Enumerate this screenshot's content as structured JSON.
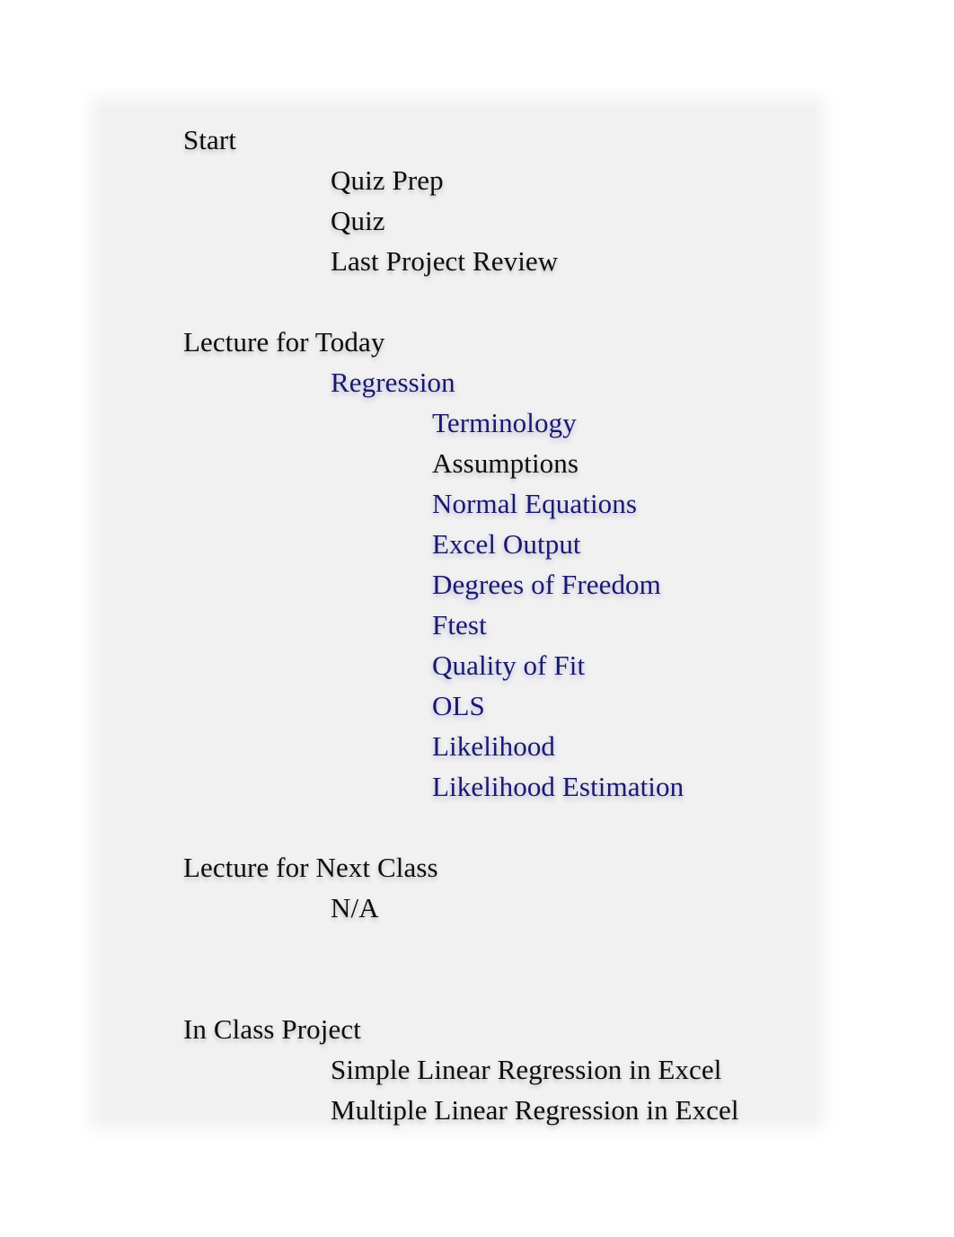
{
  "document": {
    "page_background": "#f1f1f1",
    "canvas_background": "#ffffff",
    "text_color": "#0d0d0d",
    "link_color": "#191970"
  },
  "outline": {
    "sections": [
      {
        "heading": "Start",
        "items": [
          {
            "label": "Quiz Prep",
            "level": 1,
            "style": "plain"
          },
          {
            "label": "Quiz",
            "level": 1,
            "style": "plain"
          },
          {
            "label": "Last Project Review",
            "level": 1,
            "style": "plain"
          }
        ]
      },
      {
        "heading": "Lecture for Today",
        "items": [
          {
            "label": "Regression",
            "level": 1,
            "style": "link"
          },
          {
            "label": "Terminology",
            "level": 2,
            "style": "link"
          },
          {
            "label": "Assumptions",
            "level": 2,
            "style": "plain"
          },
          {
            "label": "Normal Equations",
            "level": 2,
            "style": "link"
          },
          {
            "label": "Excel Output",
            "level": 2,
            "style": "link"
          },
          {
            "label": "Degrees of Freedom",
            "level": 2,
            "style": "link"
          },
          {
            "label": "Ftest",
            "level": 2,
            "style": "link"
          },
          {
            "label": "Quality of Fit",
            "level": 2,
            "style": "link"
          },
          {
            "label": "OLS",
            "level": 2,
            "style": "link"
          },
          {
            "label": "Likelihood",
            "level": 2,
            "style": "link"
          },
          {
            "label": "Likelihood Estimation",
            "level": 2,
            "style": "link"
          }
        ]
      },
      {
        "heading": "Lecture for Next Class",
        "items": [
          {
            "label": "N/A",
            "level": 1,
            "style": "plain"
          }
        ]
      },
      {
        "heading": "In Class Project",
        "items": [
          {
            "label": "Simple Linear Regression in Excel",
            "level": 1,
            "style": "plain"
          },
          {
            "label": "Multiple Linear Regression in Excel",
            "level": 1,
            "style": "plain"
          }
        ]
      }
    ],
    "section_gaps": [
      1,
      1,
      2
    ]
  }
}
